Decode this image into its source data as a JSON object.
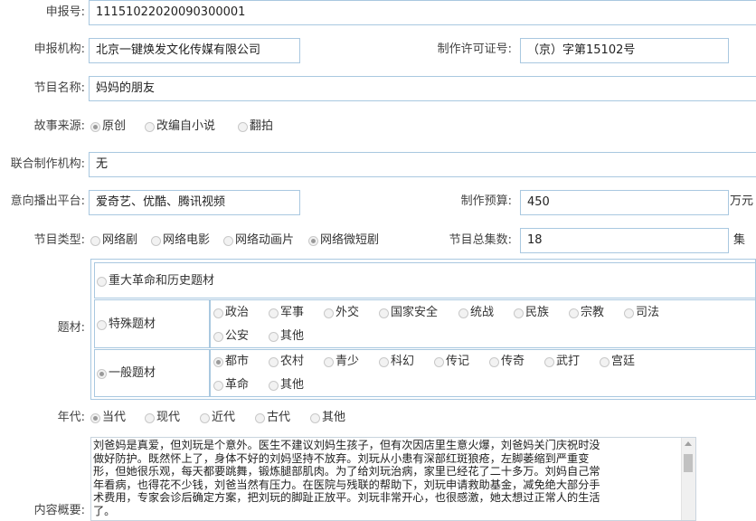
{
  "form": {
    "report_no": {
      "label": "申报号:",
      "value": "11151022020090300001"
    },
    "org": {
      "label": "申报机构:",
      "value": "北京一键焕发文化传媒有限公司"
    },
    "license": {
      "label": "制作许可证号:",
      "value": "（京）字第15102号"
    },
    "program_name": {
      "label": "节目名称:",
      "value": "妈妈的朋友"
    },
    "story_source": {
      "label": "故事来源:",
      "options": [
        {
          "label": "原创",
          "checked": true
        },
        {
          "label": "改编自小说",
          "checked": false
        },
        {
          "label": "翻拍",
          "checked": false
        }
      ]
    },
    "co_producer": {
      "label": "联合制作机构:",
      "value": "无"
    },
    "platform": {
      "label": "意向播出平台:",
      "value": "爱奇艺、优酷、腾讯视频"
    },
    "budget": {
      "label": "制作预算:",
      "value": "450",
      "unit": "万元"
    },
    "program_type": {
      "label": "节目类型:",
      "options": [
        {
          "label": "网络剧",
          "checked": false
        },
        {
          "label": "网络电影",
          "checked": false
        },
        {
          "label": "网络动画片",
          "checked": false
        },
        {
          "label": "网络微短剧",
          "checked": true
        }
      ]
    },
    "episodes": {
      "label": "节目总集数:",
      "value": "18",
      "unit": "集"
    },
    "theme": {
      "label": "题材:",
      "major": {
        "label": "重大革命和历史题材",
        "checked": false
      },
      "special": {
        "label": "特殊题材",
        "checked": false,
        "options": [
          {
            "label": "政治",
            "checked": false
          },
          {
            "label": "军事",
            "checked": false
          },
          {
            "label": "外交",
            "checked": false
          },
          {
            "label": "国家安全",
            "checked": false
          },
          {
            "label": "统战",
            "checked": false
          },
          {
            "label": "民族",
            "checked": false
          },
          {
            "label": "宗教",
            "checked": false
          },
          {
            "label": "司法",
            "checked": false
          },
          {
            "label": "公安",
            "checked": false
          },
          {
            "label": "其他",
            "checked": false
          }
        ]
      },
      "general": {
        "label": "一般题材",
        "checked": true,
        "options": [
          {
            "label": "都市",
            "checked": true
          },
          {
            "label": "农村",
            "checked": false
          },
          {
            "label": "青少",
            "checked": false
          },
          {
            "label": "科幻",
            "checked": false
          },
          {
            "label": "传记",
            "checked": false
          },
          {
            "label": "传奇",
            "checked": false
          },
          {
            "label": "武打",
            "checked": false
          },
          {
            "label": "宫廷",
            "checked": false
          },
          {
            "label": "革命",
            "checked": false
          },
          {
            "label": "其他",
            "checked": false
          }
        ]
      }
    },
    "era": {
      "label": "年代:",
      "options": [
        {
          "label": "当代",
          "checked": true
        },
        {
          "label": "现代",
          "checked": false
        },
        {
          "label": "近代",
          "checked": false
        },
        {
          "label": "古代",
          "checked": false
        },
        {
          "label": "其他",
          "checked": false
        }
      ]
    },
    "summary": {
      "label": "内容概要:",
      "lines": [
        "刘爸妈是真爱，但刘玩是个意外。医生不建议刘妈生孩子，但有次因店里生意火爆，刘爸妈关门庆祝时没",
        "做好防护。既然怀上了，身体不好的刘妈坚持不放弃。刘玩从小患有深部红斑狼疮，左脚萎缩到严重变",
        "形，但她很乐观，每天都要跳舞，锻炼腿部肌肉。为了给刘玩治病，家里已经花了二十多万。刘妈自己常",
        "年看病，也得花不少钱，刘爸当然有压力。在医院与残联的帮助下，刘玩申请救助基金，减免绝大部分手",
        "术费用，专家会诊后确定方案，把刘玩的脚趾正放平。刘玩非常开心，也很感激，她太想过正常人的生活",
        "了。"
      ]
    }
  }
}
